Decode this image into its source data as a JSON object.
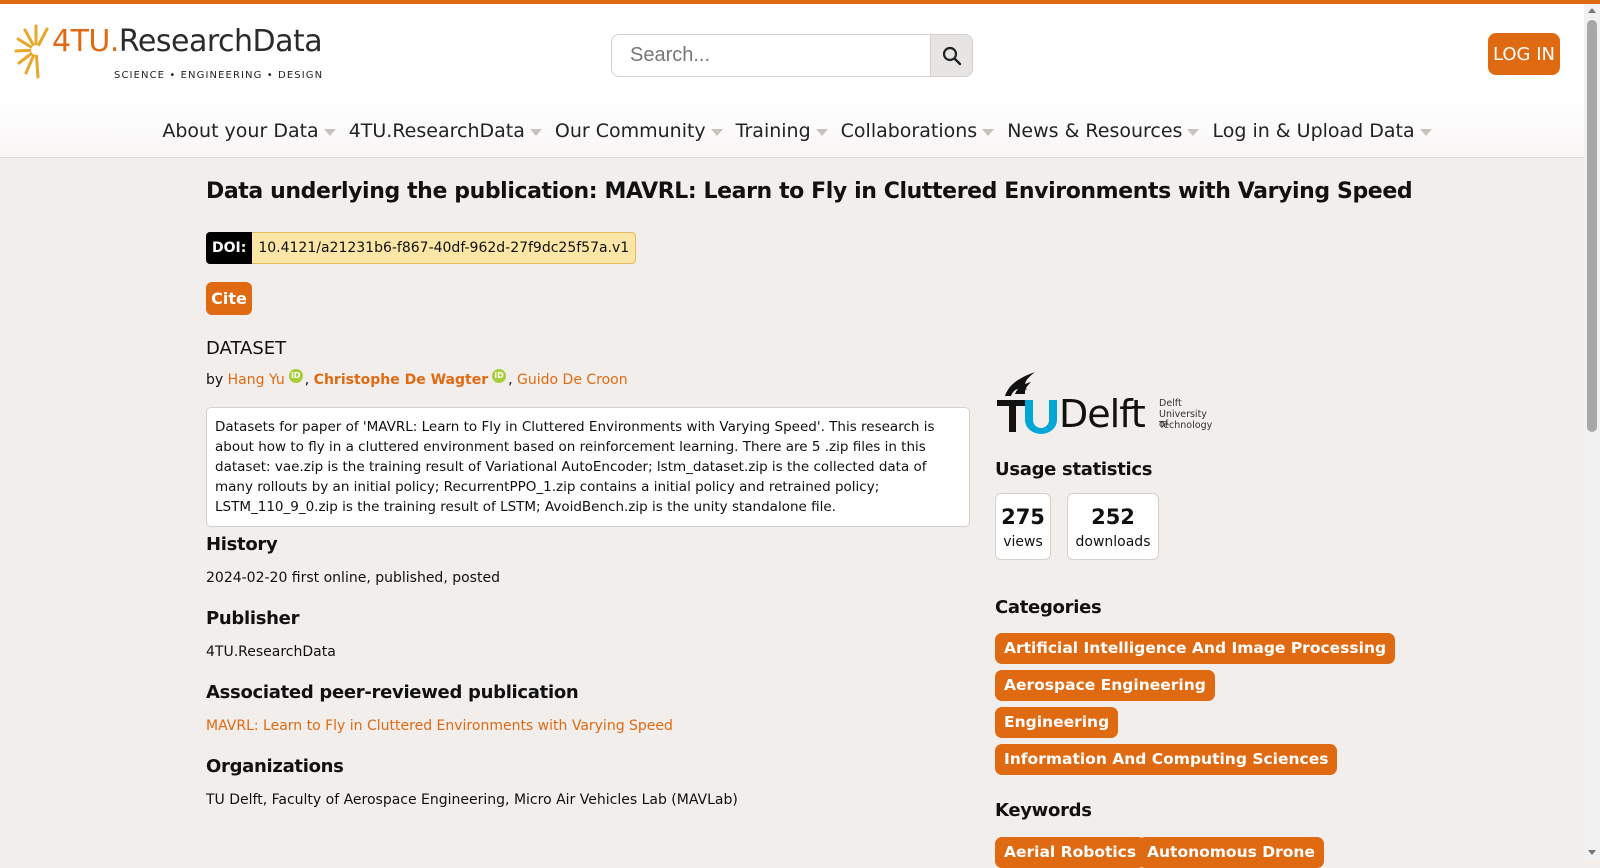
{
  "header": {
    "logo_prefix": "4TU.",
    "logo_name": "ResearchData",
    "logo_tagline": "SCIENCE • ENGINEERING • DESIGN",
    "search_placeholder": "Search...",
    "search_icon": "search-icon",
    "login_label": "LOG IN"
  },
  "nav": {
    "items": [
      {
        "label": "About your Data"
      },
      {
        "label": "4TU.ResearchData"
      },
      {
        "label": "Our Community"
      },
      {
        "label": "Training"
      },
      {
        "label": "Collaborations"
      },
      {
        "label": "News & Resources"
      },
      {
        "label": "Log in & Upload Data"
      }
    ]
  },
  "dataset": {
    "title": "Data underlying the publication: MAVRL: Learn to Fly in Cluttered Environments with Varying Speed",
    "doi_label": "DOI:",
    "doi_value": "10.4121/a21231b6-f867-40df-962d-27f9dc25f57a.v1",
    "cite_label": "Cite",
    "type_label": "DATASET",
    "by_label": "by",
    "authors": [
      {
        "name": "Hang Yu"
      },
      {
        "name": "Christophe De Wagter"
      },
      {
        "name": "Guido De Croon"
      }
    ],
    "orcid_label": "iD",
    "abstract": "Datasets for paper of 'MAVRL: Learn to Fly in Cluttered Environments with Varying Speed'. This research is about how to fly in a cluttered environment based on reinforcement learning. There are 5 .zip files in this dataset: vae.zip is the training result of Variational AutoEncoder; lstm_dataset.zip is the collected data of many rollouts by an initial policy; RecurrentPPO_1.zip contains a initial policy and retrained policy; LSTM_110_9_0.zip is the training result of LSTM; AvoidBench.zip is the unity standalone file.",
    "history_heading": "History",
    "history_value": "2024-02-20 first online, published, posted",
    "publisher_heading": "Publisher",
    "publisher_value": "4TU.ResearchData",
    "publication_heading": "Associated peer-reviewed publication",
    "publication_value": "MAVRL: Learn to Fly in Cluttered Environments with Varying Speed",
    "organizations_heading": "Organizations",
    "organizations_value": "TU Delft, Faculty of Aerospace Engineering, Micro Air Vehicles Lab (MAVLab)"
  },
  "sidebar": {
    "institution_name": "Delft",
    "institution_line1": "Delft",
    "institution_line2": "University of",
    "institution_line3": "Technology",
    "usage_heading": "Usage statistics",
    "views_value": "275",
    "views_label": "views",
    "downloads_value": "252",
    "downloads_label": "downloads",
    "categories_heading": "Categories",
    "categories": [
      "Artificial Intelligence And Image Processing",
      "Aerospace Engineering",
      "Engineering",
      "Information And Computing Sciences"
    ],
    "keywords_heading": "Keywords",
    "keywords": [
      "Aerial Robotics",
      "Autonomous Drone"
    ]
  },
  "theme": {
    "accent": "#e06a12",
    "background": "#f1eeec",
    "doi_highlight": "#fbe6a6",
    "orcid_green": "#a6ce39",
    "tud_blue": "#00a6d6"
  }
}
